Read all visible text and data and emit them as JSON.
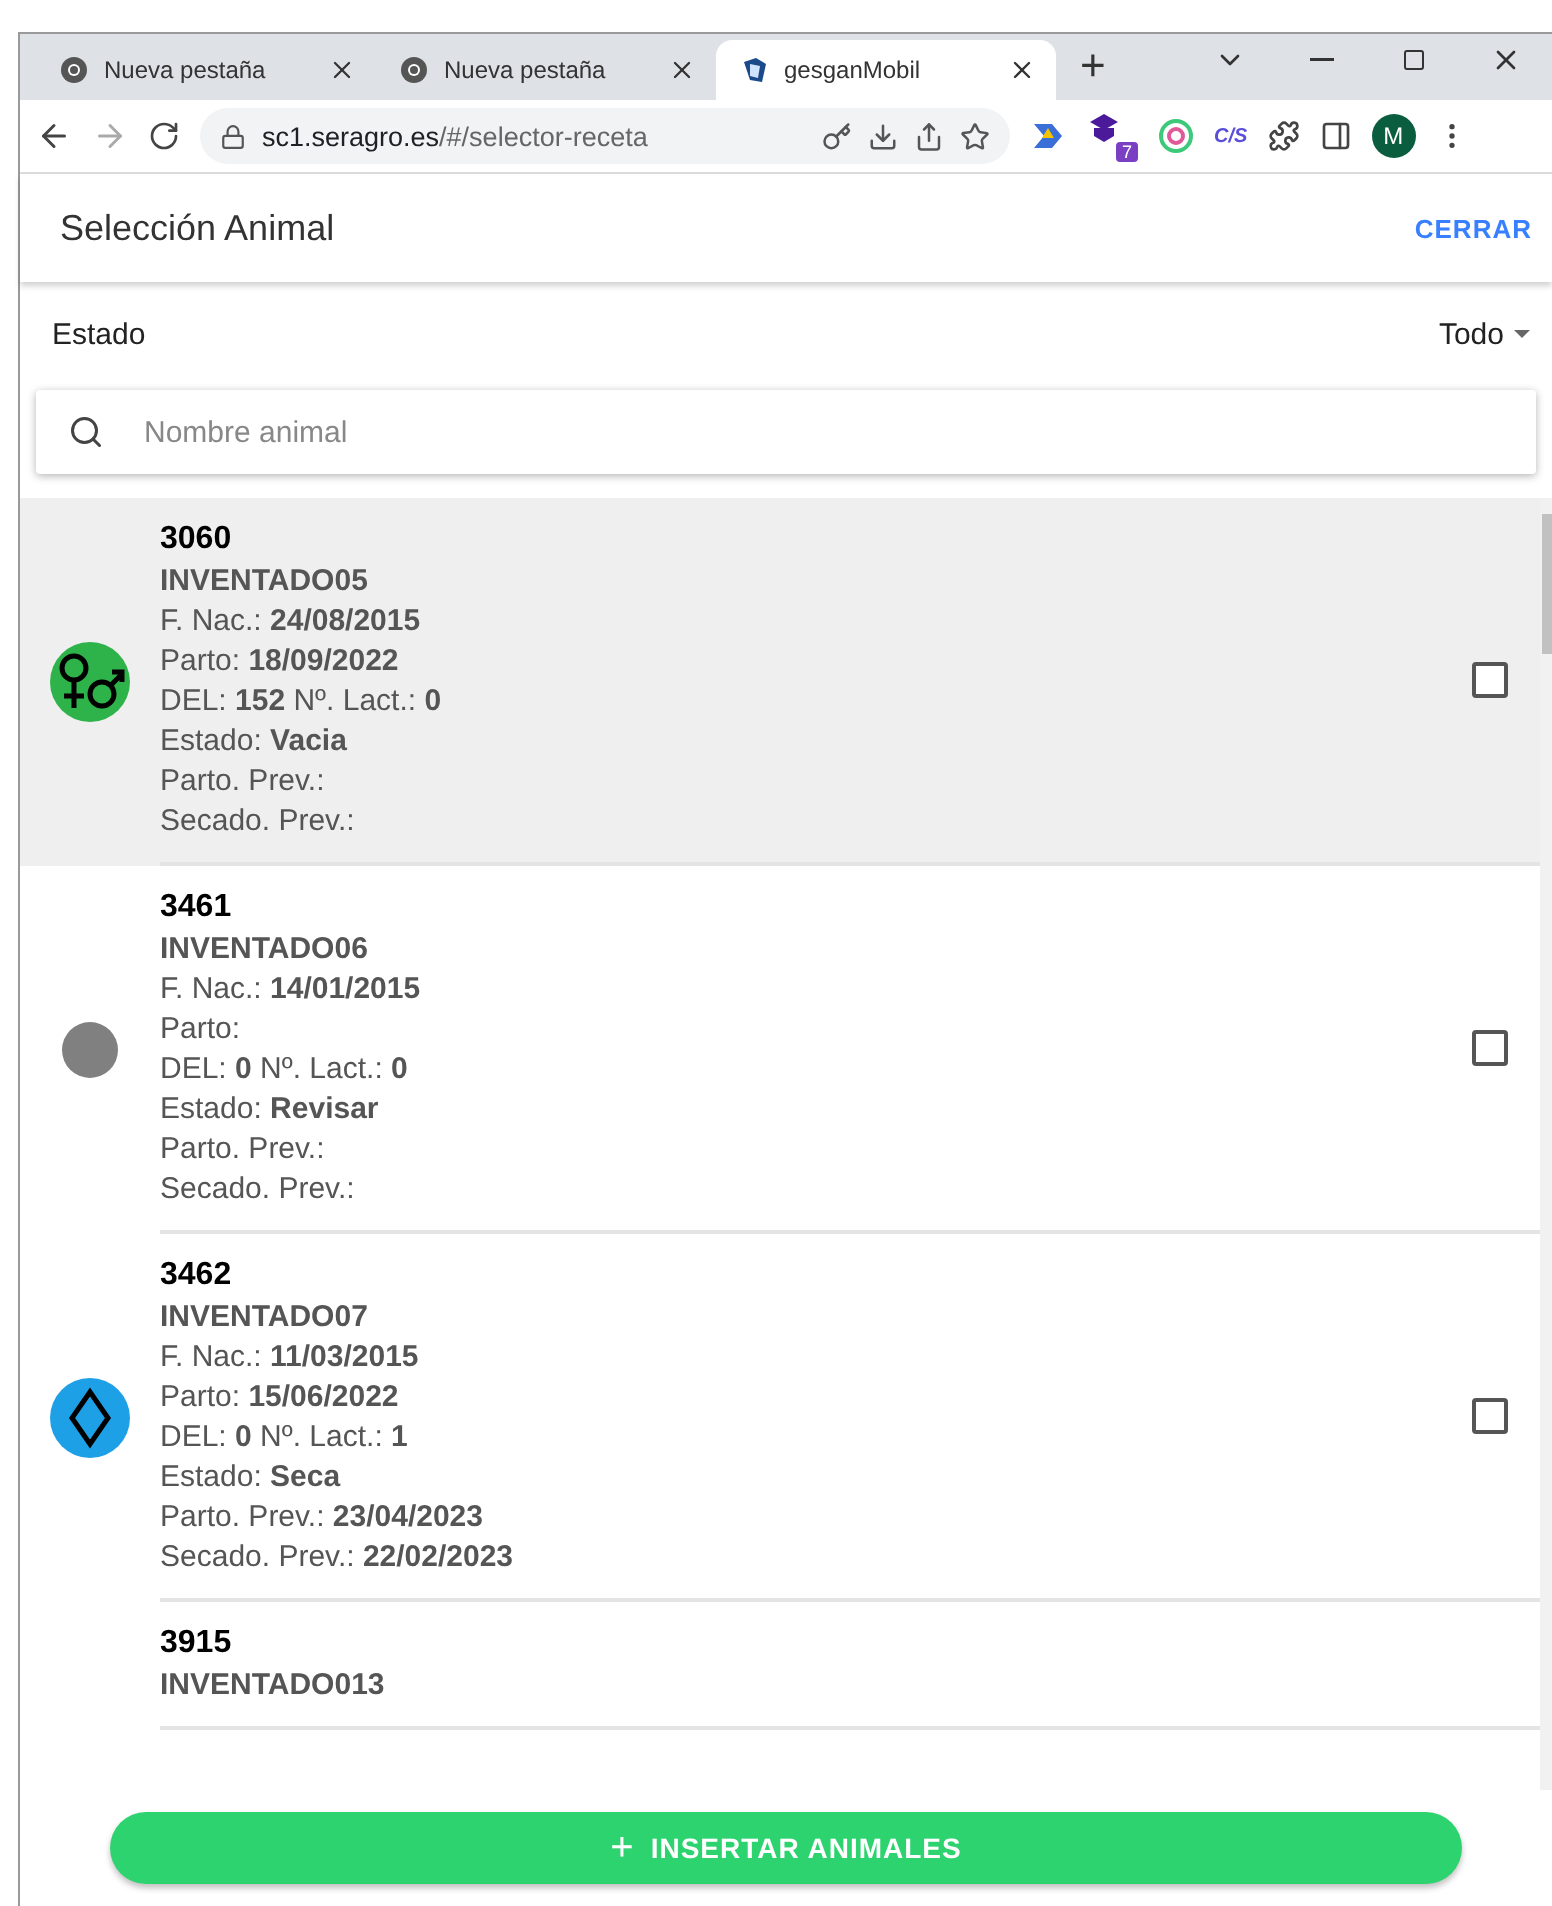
{
  "browser": {
    "tabs": [
      {
        "title": "Nueva pestaña",
        "kind": "chrome",
        "selected": false
      },
      {
        "title": "Nueva pestaña",
        "kind": "chrome",
        "selected": false
      },
      {
        "title": "gesganMobil",
        "kind": "app",
        "selected": true
      }
    ],
    "new_tab": "+",
    "url_host": "sc1.seragro.es",
    "url_path": "/#/selector-receta",
    "extension_badge": "7",
    "extension_label": "C/S",
    "profile_initial": "M"
  },
  "header": {
    "title": "Selección Animal",
    "close": "CERRAR"
  },
  "filter": {
    "label": "Estado",
    "value": "Todo"
  },
  "search": {
    "placeholder": "Nombre animal"
  },
  "animals": [
    {
      "number": "3060",
      "name": "INVENTADO05",
      "kind": "sexes",
      "color": "#2db34a",
      "selected": true,
      "checked": false,
      "lines": [
        "F. Nac.: **24/08/2015**",
        "Parto: **18/09/2022**",
        "DEL: **152** Nº. Lact.: **0**",
        "Estado: **Vacia**",
        "Parto. Prev.:",
        "Secado. Prev.:"
      ]
    },
    {
      "number": "3461",
      "name": "INVENTADO06",
      "kind": "plain",
      "color": "#808080",
      "selected": false,
      "checked": false,
      "lines": [
        "F. Nac.: **14/01/2015**",
        "Parto:",
        "DEL: **0** Nº. Lact.: **0**",
        "Estado: **Revisar**",
        "Parto. Prev.:",
        "Secado. Prev.:"
      ]
    },
    {
      "number": "3462",
      "name": "INVENTADO07",
      "kind": "diamond",
      "color": "#1ea0e6",
      "selected": false,
      "checked": false,
      "lines": [
        "F. Nac.: **11/03/2015**",
        "Parto: **15/06/2022**",
        "DEL: **0** Nº. Lact.: **1**",
        "Estado: **Seca**",
        "Parto. Prev.: **23/04/2023**",
        "Secado. Prev.: **22/02/2023**"
      ]
    },
    {
      "number": "3915",
      "name": "INVENTADO013",
      "kind": "partial",
      "selected": false
    }
  ],
  "insert_button": {
    "icon": "+",
    "label": "INSERTAR ANIMALES"
  }
}
